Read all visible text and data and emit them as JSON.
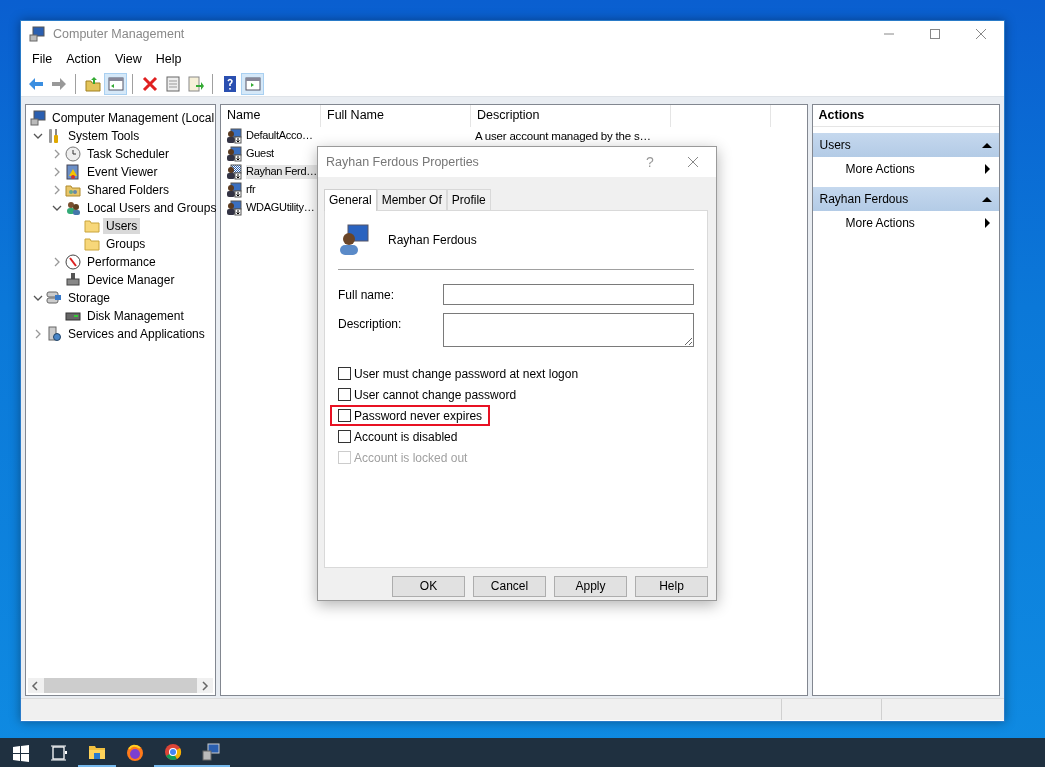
{
  "window": {
    "title": "Computer Management"
  },
  "menu": [
    "File",
    "Action",
    "View",
    "Help"
  ],
  "toolbar": [
    [
      {
        "kind": "back",
        "disabled": false,
        "on": false
      },
      {
        "kind": "forward",
        "disabled": true,
        "on": false
      }
    ],
    [
      {
        "kind": "up",
        "disabled": false,
        "on": false
      },
      {
        "kind": "tree-pane",
        "disabled": false,
        "on": true
      }
    ],
    [
      {
        "kind": "delete",
        "disabled": false,
        "on": false
      },
      {
        "kind": "properties",
        "disabled": false,
        "on": false
      },
      {
        "kind": "export",
        "disabled": false,
        "on": false
      }
    ],
    [
      {
        "kind": "help",
        "disabled": false,
        "on": false
      },
      {
        "kind": "action-pane",
        "disabled": false,
        "on": true
      }
    ]
  ],
  "tree": [
    {
      "label": "Computer Management (Local",
      "kind": "computer",
      "selected": false,
      "children": [
        {
          "label": "System Tools",
          "kind": "tools",
          "expanded": true,
          "selected": false,
          "children": [
            {
              "label": "Task Scheduler",
              "kind": "clock",
              "expanded": false,
              "selected": false
            },
            {
              "label": "Event Viewer",
              "kind": "log",
              "expanded": false,
              "selected": false
            },
            {
              "label": "Shared Folders",
              "kind": "shared",
              "expanded": false,
              "selected": false
            },
            {
              "label": "Local Users and Groups",
              "kind": "users",
              "expanded": true,
              "selected": false,
              "children": [
                {
                  "label": "Users",
                  "kind": "folder",
                  "selected": true
                },
                {
                  "label": "Groups",
                  "kind": "folder",
                  "selected": false
                }
              ]
            },
            {
              "label": "Performance",
              "kind": "gauge",
              "expanded": false,
              "selected": false
            },
            {
              "label": "Device Manager",
              "kind": "device",
              "selected": false
            }
          ]
        },
        {
          "label": "Storage",
          "kind": "storage",
          "expanded": true,
          "selected": false,
          "children": [
            {
              "label": "Disk Management",
              "kind": "disk",
              "selected": false
            }
          ]
        },
        {
          "label": "Services and Applications",
          "kind": "services",
          "expanded": false,
          "selected": false
        }
      ]
    }
  ],
  "list": {
    "columns": [
      "Name",
      "Full Name",
      "Description"
    ],
    "rows": [
      {
        "name": "DefaultAcco…",
        "description": "A user account managed by the s…",
        "selected": false
      },
      {
        "name": "Guest",
        "selected": false
      },
      {
        "name": "Rayhan Ferd…",
        "selected": true
      },
      {
        "name": "rfr",
        "selected": false
      },
      {
        "name": "WDAGUtility…",
        "selected": false
      }
    ]
  },
  "actions": {
    "title": "Actions",
    "sections": [
      {
        "title": "Users",
        "items": [
          "More Actions"
        ]
      },
      {
        "title": "Rayhan Ferdous",
        "items": [
          "More Actions"
        ]
      }
    ]
  },
  "dialog": {
    "title": "Rayhan Ferdous Properties",
    "help_button": "?",
    "tabs": [
      {
        "label": "General",
        "selected": true
      },
      {
        "label": "Member Of",
        "selected": false
      },
      {
        "label": "Profile",
        "selected": false
      }
    ],
    "user_name": "Rayhan Ferdous",
    "fields": [
      {
        "label": "Full name:",
        "kind": "line"
      },
      {
        "label": "Description:",
        "kind": "box"
      }
    ],
    "checkboxes": [
      {
        "label": "User must change password at next logon",
        "checked": false,
        "disabled": false,
        "highlighted": false
      },
      {
        "label": "User cannot change password",
        "checked": false,
        "disabled": false,
        "highlighted": false
      },
      {
        "label": "Password never expires",
        "checked": false,
        "disabled": false,
        "highlighted": true
      },
      {
        "label": "Account is disabled",
        "checked": false,
        "disabled": false,
        "highlighted": false
      },
      {
        "label": "Account is locked out",
        "checked": false,
        "disabled": true,
        "highlighted": false
      }
    ],
    "buttons": [
      "OK",
      "Cancel",
      "Apply",
      "Help"
    ]
  },
  "taskbar": [
    {
      "kind": "start",
      "running": false
    },
    {
      "kind": "task-view",
      "running": false
    },
    {
      "kind": "explorer",
      "running": true
    },
    {
      "kind": "firefox",
      "running": false
    },
    {
      "kind": "chrome",
      "running": true
    },
    {
      "kind": "computer-management",
      "running": true
    }
  ]
}
